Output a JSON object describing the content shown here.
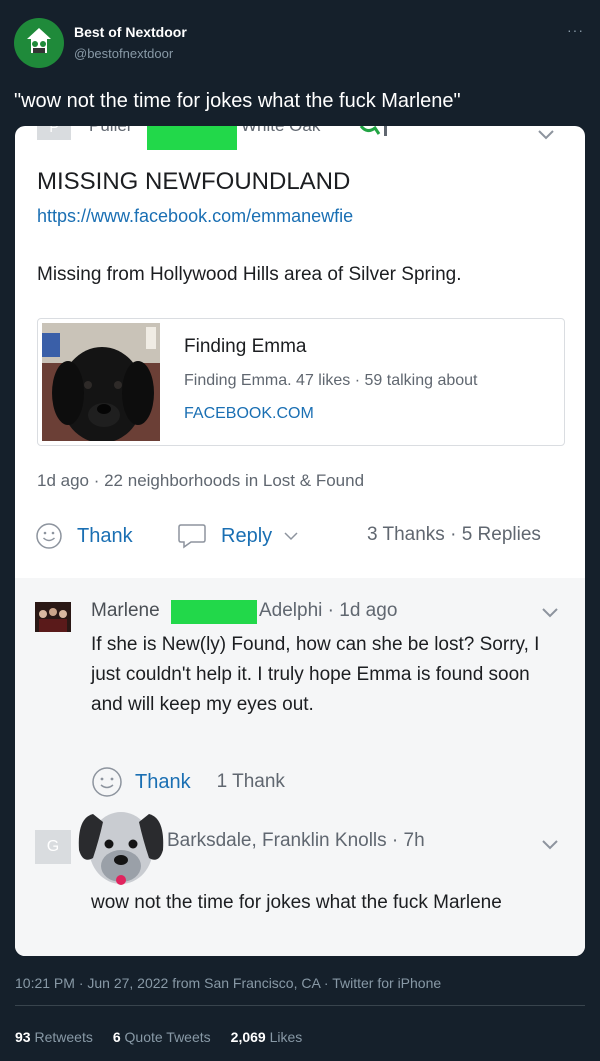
{
  "tweet": {
    "author_name": "Best of Nextdoor",
    "author_handle": "@bestofnextdoor",
    "more_icon": "more-icon",
    "text": "\"wow not the time for jokes what the fuck Marlene\"",
    "timestamp": "10:21 PM · Jun 27, 2022 from San Francisco, CA · Twitter for iPhone",
    "stats": {
      "retweets_count": "93",
      "retweets_label": "Retweets",
      "quote_count": "6",
      "quote_label": "Quote Tweets",
      "likes_count": "2,069",
      "likes_label": "Likes"
    }
  },
  "nextdoor": {
    "cut_row": {
      "avatar_letter": "P",
      "name": "Puller",
      "location": "White Oak"
    },
    "post": {
      "title": "MISSING NEWFOUNDLAND",
      "link": "https://www.facebook.com/emmanewfie",
      "body": "Missing from Hollywood Hills area of Silver Spring.",
      "link_card": {
        "title": "Finding Emma",
        "description": "Finding Emma. 47 likes · 59 talking about",
        "domain": "FACEBOOK.COM"
      },
      "meta": "1d ago · 22 neighborhoods in Lost & Found",
      "thank_label": "Thank",
      "reply_label": "Reply",
      "stats": "3 Thanks · 5 Replies"
    },
    "comments": [
      {
        "name": "Marlene",
        "location": "Adelphi · 1d ago",
        "text": "If she is New(ly) Found, how can she be lost? Sorry, I just couldn't help it. I truly hope Emma is found soon and will keep my eyes out.",
        "thank_label": "Thank",
        "thanks_count": "1 Thank"
      },
      {
        "avatar_letter": "G",
        "location": "Barksdale, Franklin Knolls · 7h",
        "text": "wow not the time for jokes what the fuck Marlene"
      }
    ]
  },
  "colors": {
    "background": "#15202b",
    "redaction_green": "#22d84a",
    "nextdoor_link": "#1a6fb3"
  }
}
